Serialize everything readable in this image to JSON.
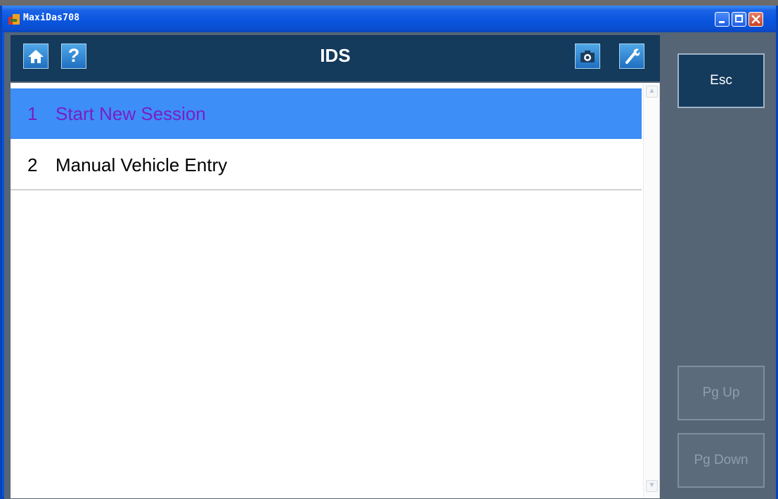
{
  "window": {
    "title": "MaxiDas708"
  },
  "toolbar": {
    "title": "IDS",
    "buttons": {
      "home_icon": "home-icon",
      "help_icon": "help-icon",
      "help_glyph": "?",
      "camera_icon": "camera-icon",
      "wrench_icon": "wrench-icon"
    }
  },
  "list": {
    "items": [
      {
        "number": "1",
        "label": "Start New Session",
        "selected": true
      },
      {
        "number": "2",
        "label": "Manual Vehicle Entry",
        "selected": false
      }
    ]
  },
  "side_buttons": {
    "esc": "Esc",
    "pg_up": "Pg Up",
    "pg_down": "Pg Down"
  },
  "colors": {
    "titlebar": "#0a55e0",
    "toolbar": "#143a5c",
    "panel_bg": "#556575",
    "selected_row": "#3d8ef7",
    "selected_text": "#7a1fc2"
  }
}
